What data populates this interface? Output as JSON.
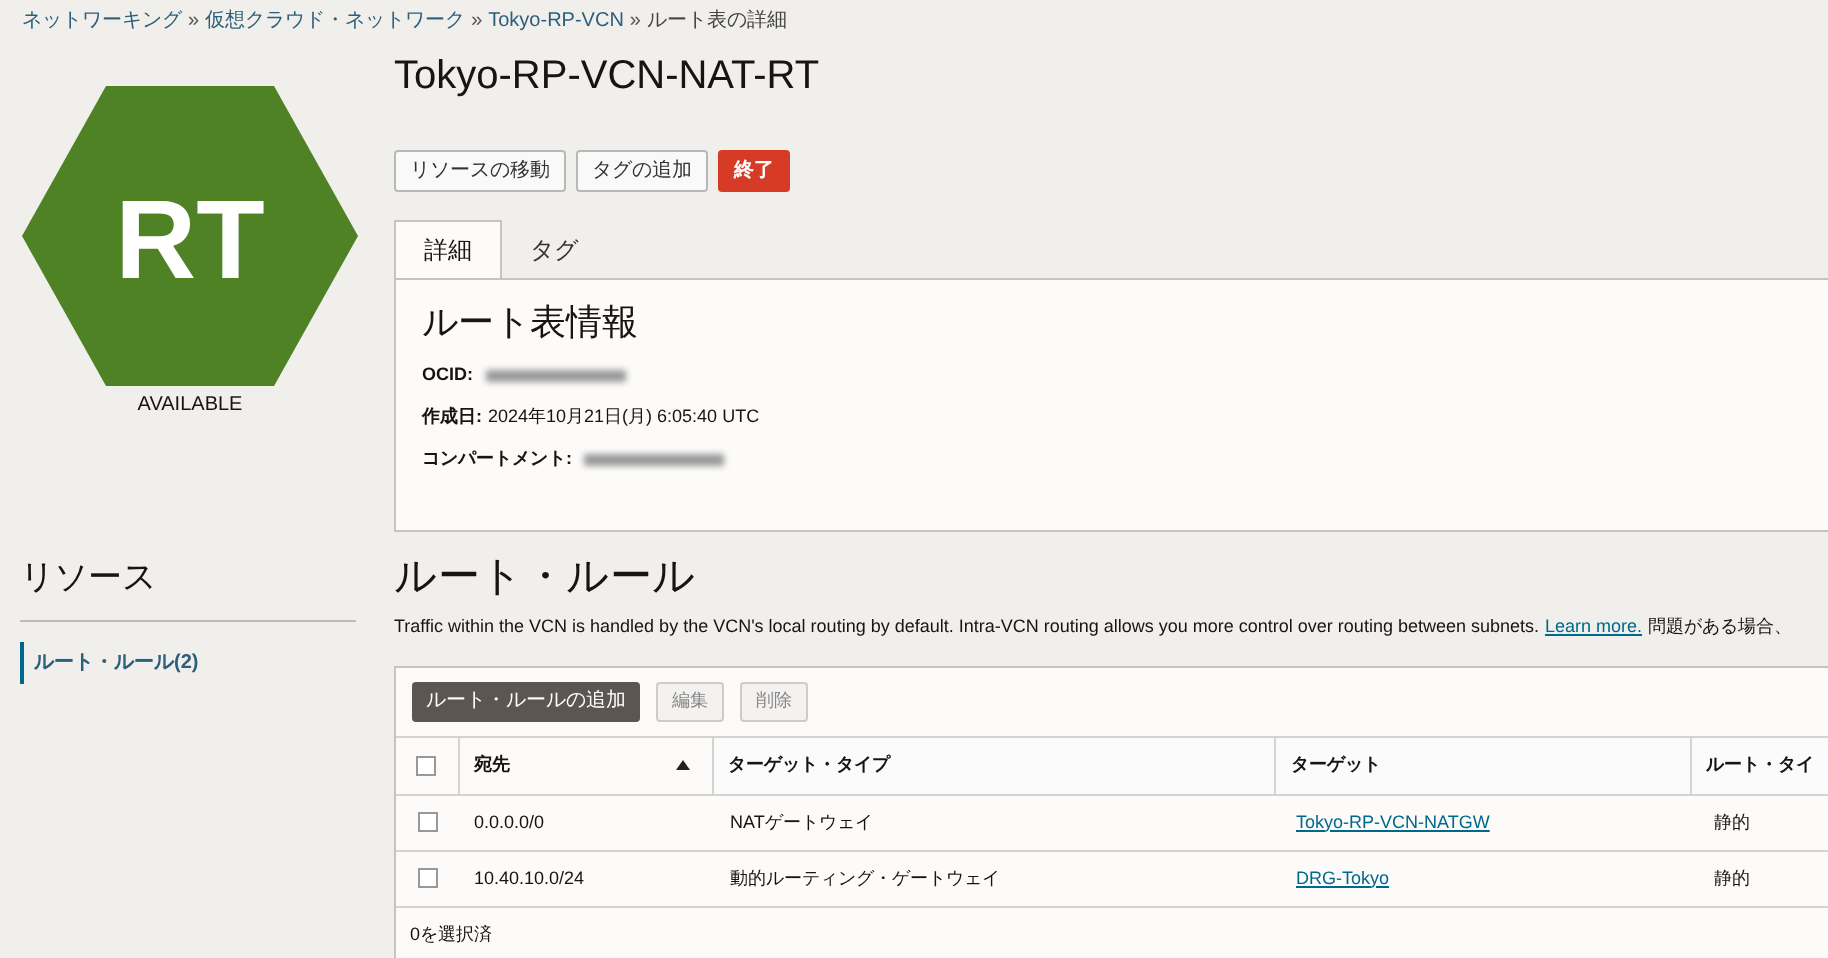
{
  "breadcrumbs": [
    {
      "label": "ネットワーキング"
    },
    {
      "label": "仮想クラウド・ネットワーク"
    },
    {
      "label": "Tokyo-RP-VCN"
    },
    {
      "label": "ルート表の詳細"
    }
  ],
  "breadcrumb_separator": "»",
  "badge": {
    "initials": "RT",
    "status": "AVAILABLE"
  },
  "title": "Tokyo-RP-VCN-NAT-RT",
  "actions": [
    {
      "label": "リソースの移動",
      "kind": "default"
    },
    {
      "label": "タグの追加",
      "kind": "default"
    },
    {
      "label": "終了",
      "kind": "danger"
    }
  ],
  "tabs": [
    {
      "label": "詳細",
      "selected": true
    },
    {
      "label": "タグ",
      "selected": false
    }
  ],
  "info": {
    "heading": "ルート表情報",
    "fields": [
      {
        "label": "OCID:",
        "redacted": true
      },
      {
        "label": "作成日:",
        "value": "2024年10月21日(月) 6:05:40 UTC",
        "redacted": false
      },
      {
        "label": "コンパートメント:",
        "redacted": true
      }
    ]
  },
  "resources": {
    "heading": "リソース",
    "items": [
      {
        "label": "ルート・ルール(2)",
        "selected": true
      }
    ]
  },
  "rules": {
    "heading": "ルート・ルール",
    "description": "Traffic within the VCN is handled by the VCN's local routing by default. Intra-VCN routing allows you more control over routing between subnets.",
    "link": "Learn more.",
    "description_tail": "問題がある場合、",
    "toolbar": [
      {
        "label": "ルート・ルールの追加",
        "disabled": false
      },
      {
        "label": "編集",
        "disabled": true
      },
      {
        "label": "削除",
        "disabled": true
      }
    ],
    "all_checked": false,
    "columns": [
      {
        "label": "宛先",
        "sorted": true
      },
      {
        "label": "ターゲット・タイプ",
        "sorted": false
      },
      {
        "label": "ターゲット",
        "sorted": false
      },
      {
        "label": "ルート・タイ",
        "sorted": false
      }
    ],
    "rows": [
      {
        "checked": false,
        "cells": [
          "0.0.0.0/0",
          "NATゲートウェイ",
          "Tokyo-RP-VCN-NATGW",
          "静的"
        ]
      },
      {
        "checked": false,
        "cells": [
          "10.40.10.0/24",
          "動的ルーティング・ゲートウェイ",
          "DRG-Tokyo",
          "静的"
        ]
      }
    ],
    "selection": "0を選択済"
  }
}
